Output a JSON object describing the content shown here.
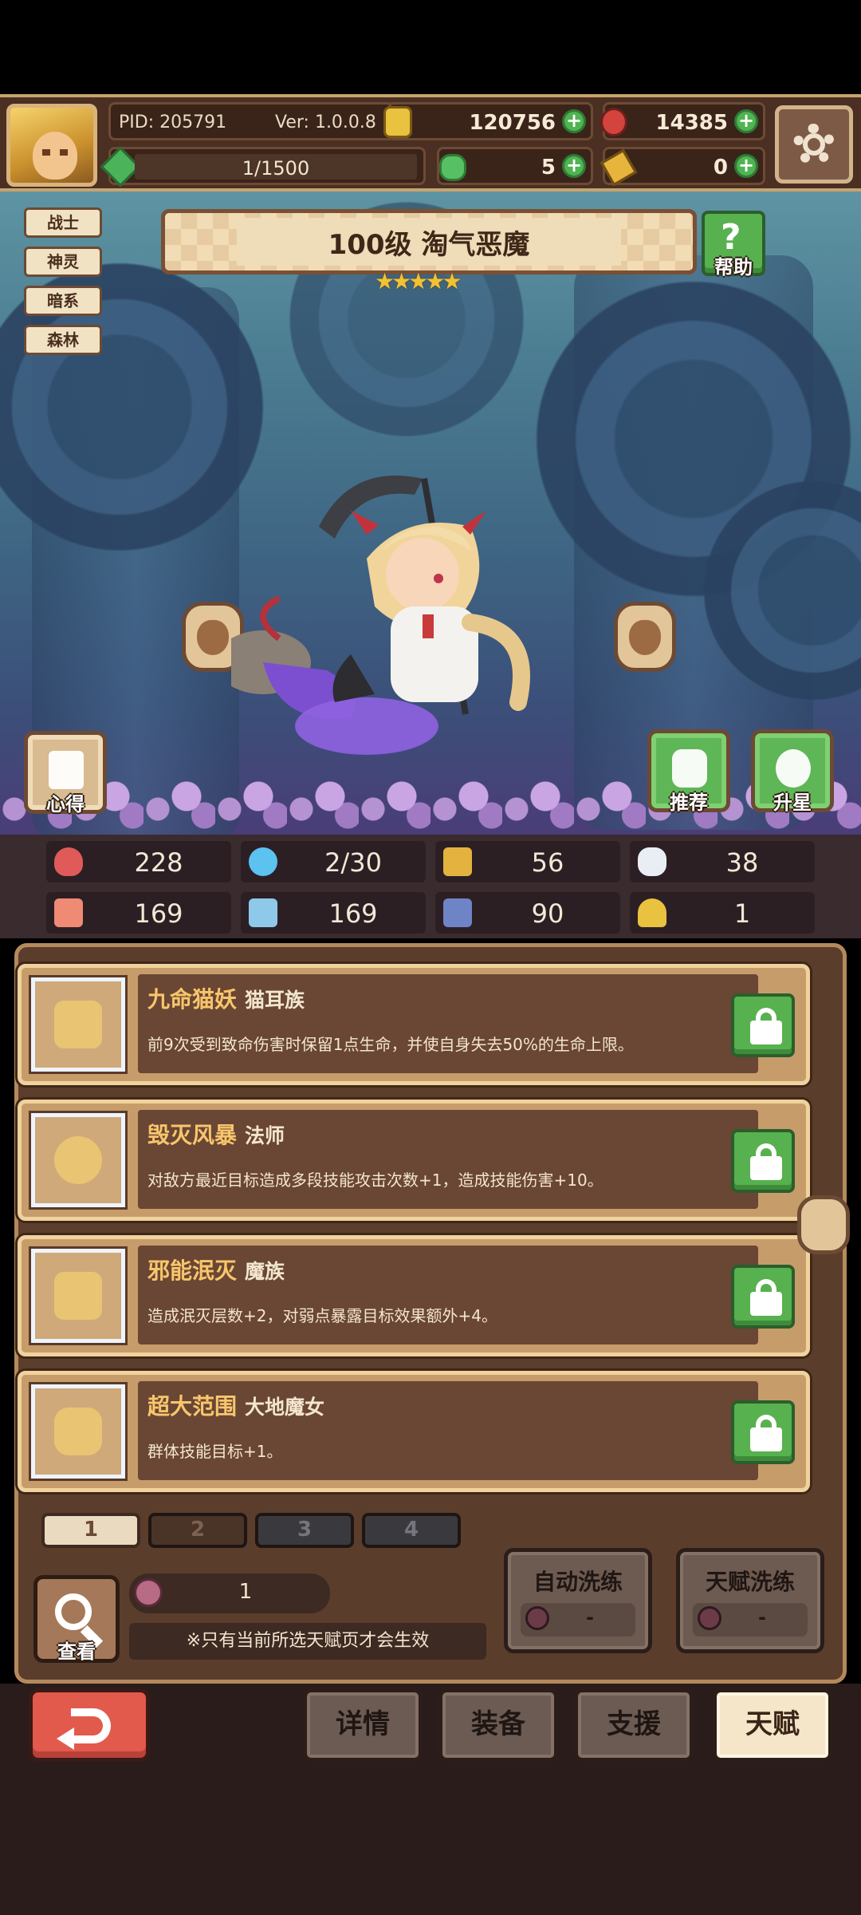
{
  "topbar": {
    "pid": "PID: 205791",
    "version": "Ver: 1.0.0.8",
    "gold": "120756",
    "gems": "14385",
    "exp": "1/1500",
    "clover": "5",
    "keys": "0"
  },
  "class_tags": [
    "战士",
    "神灵",
    "暗系",
    "森林"
  ],
  "hero": {
    "title": "100级  淘气恶魔",
    "stars": 5,
    "help_label": "帮助",
    "insight_label": "心得",
    "recommend_label": "推荐",
    "star_up_label": "升星"
  },
  "stats": [
    {
      "icon": "heart-icon",
      "value": "228"
    },
    {
      "icon": "droplet-icon",
      "value": "2/30"
    },
    {
      "icon": "shield-icon",
      "value": "56"
    },
    {
      "icon": "wing-icon",
      "value": "38"
    },
    {
      "icon": "fist-icon",
      "value": "169"
    },
    {
      "icon": "book-icon",
      "value": "169"
    },
    {
      "icon": "boot-icon",
      "value": "90"
    },
    {
      "icon": "horseshoe-icon",
      "value": "1"
    }
  ],
  "talents": [
    {
      "name": "九命猫妖",
      "tribe": "猫耳族",
      "desc": "前9次受到致命伤害时保留1点生命，并使自身失去50%的生命上限。",
      "icon": "cat-icon"
    },
    {
      "name": "毁灭风暴",
      "tribe": "法师",
      "desc": "对敌方最近目标造成多段技能攻击次数+1，造成技能伤害+10。",
      "icon": "staff-icon"
    },
    {
      "name": "邪能泯灭",
      "tribe": "魔族",
      "desc": "造成泯灭层数+2，对弱点暴露目标效果额外+4。",
      "icon": "demon-icon"
    },
    {
      "name": "超大范围",
      "tribe": "大地魔女",
      "desc": "群体技能目标+1。",
      "icon": "star-icon"
    }
  ],
  "pages": [
    "1",
    "2",
    "3",
    "4"
  ],
  "footer": {
    "query_label": "查看",
    "fruit_count": "1",
    "note": "※只有当前所选天赋页才会生效",
    "auto_wash": "自动洗练",
    "auto_wash_value": "-",
    "talent_wash": "天赋洗练",
    "talent_wash_value": "-"
  },
  "nav": [
    "详情",
    "装备",
    "支援",
    "天赋"
  ]
}
